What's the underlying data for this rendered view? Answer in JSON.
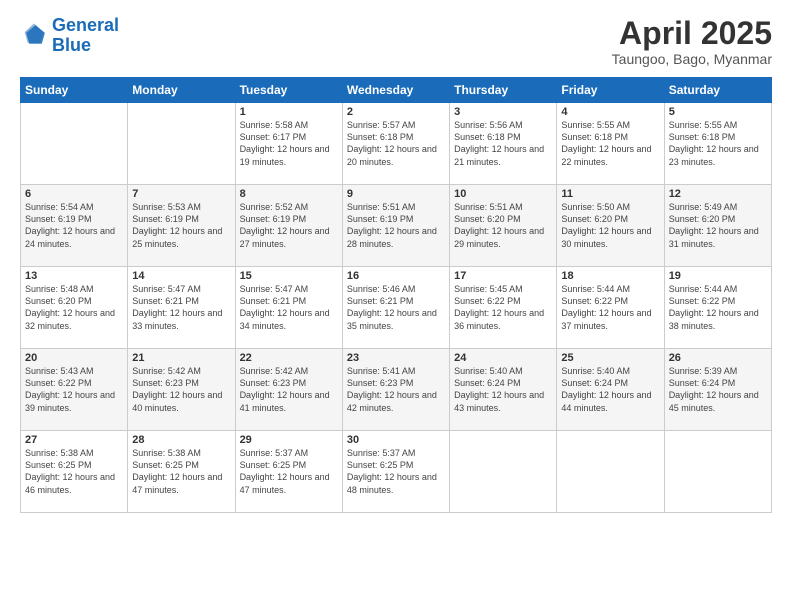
{
  "logo": {
    "line1": "General",
    "line2": "Blue"
  },
  "header": {
    "month": "April 2025",
    "location": "Taungoo, Bago, Myanmar"
  },
  "weekdays": [
    "Sunday",
    "Monday",
    "Tuesday",
    "Wednesday",
    "Thursday",
    "Friday",
    "Saturday"
  ],
  "weeks": [
    [
      null,
      null,
      {
        "day": "1",
        "sunrise": "Sunrise: 5:58 AM",
        "sunset": "Sunset: 6:17 PM",
        "daylight": "Daylight: 12 hours and 19 minutes."
      },
      {
        "day": "2",
        "sunrise": "Sunrise: 5:57 AM",
        "sunset": "Sunset: 6:18 PM",
        "daylight": "Daylight: 12 hours and 20 minutes."
      },
      {
        "day": "3",
        "sunrise": "Sunrise: 5:56 AM",
        "sunset": "Sunset: 6:18 PM",
        "daylight": "Daylight: 12 hours and 21 minutes."
      },
      {
        "day": "4",
        "sunrise": "Sunrise: 5:55 AM",
        "sunset": "Sunset: 6:18 PM",
        "daylight": "Daylight: 12 hours and 22 minutes."
      },
      {
        "day": "5",
        "sunrise": "Sunrise: 5:55 AM",
        "sunset": "Sunset: 6:18 PM",
        "daylight": "Daylight: 12 hours and 23 minutes."
      }
    ],
    [
      {
        "day": "6",
        "sunrise": "Sunrise: 5:54 AM",
        "sunset": "Sunset: 6:19 PM",
        "daylight": "Daylight: 12 hours and 24 minutes."
      },
      {
        "day": "7",
        "sunrise": "Sunrise: 5:53 AM",
        "sunset": "Sunset: 6:19 PM",
        "daylight": "Daylight: 12 hours and 25 minutes."
      },
      {
        "day": "8",
        "sunrise": "Sunrise: 5:52 AM",
        "sunset": "Sunset: 6:19 PM",
        "daylight": "Daylight: 12 hours and 27 minutes."
      },
      {
        "day": "9",
        "sunrise": "Sunrise: 5:51 AM",
        "sunset": "Sunset: 6:19 PM",
        "daylight": "Daylight: 12 hours and 28 minutes."
      },
      {
        "day": "10",
        "sunrise": "Sunrise: 5:51 AM",
        "sunset": "Sunset: 6:20 PM",
        "daylight": "Daylight: 12 hours and 29 minutes."
      },
      {
        "day": "11",
        "sunrise": "Sunrise: 5:50 AM",
        "sunset": "Sunset: 6:20 PM",
        "daylight": "Daylight: 12 hours and 30 minutes."
      },
      {
        "day": "12",
        "sunrise": "Sunrise: 5:49 AM",
        "sunset": "Sunset: 6:20 PM",
        "daylight": "Daylight: 12 hours and 31 minutes."
      }
    ],
    [
      {
        "day": "13",
        "sunrise": "Sunrise: 5:48 AM",
        "sunset": "Sunset: 6:20 PM",
        "daylight": "Daylight: 12 hours and 32 minutes."
      },
      {
        "day": "14",
        "sunrise": "Sunrise: 5:47 AM",
        "sunset": "Sunset: 6:21 PM",
        "daylight": "Daylight: 12 hours and 33 minutes."
      },
      {
        "day": "15",
        "sunrise": "Sunrise: 5:47 AM",
        "sunset": "Sunset: 6:21 PM",
        "daylight": "Daylight: 12 hours and 34 minutes."
      },
      {
        "day": "16",
        "sunrise": "Sunrise: 5:46 AM",
        "sunset": "Sunset: 6:21 PM",
        "daylight": "Daylight: 12 hours and 35 minutes."
      },
      {
        "day": "17",
        "sunrise": "Sunrise: 5:45 AM",
        "sunset": "Sunset: 6:22 PM",
        "daylight": "Daylight: 12 hours and 36 minutes."
      },
      {
        "day": "18",
        "sunrise": "Sunrise: 5:44 AM",
        "sunset": "Sunset: 6:22 PM",
        "daylight": "Daylight: 12 hours and 37 minutes."
      },
      {
        "day": "19",
        "sunrise": "Sunrise: 5:44 AM",
        "sunset": "Sunset: 6:22 PM",
        "daylight": "Daylight: 12 hours and 38 minutes."
      }
    ],
    [
      {
        "day": "20",
        "sunrise": "Sunrise: 5:43 AM",
        "sunset": "Sunset: 6:22 PM",
        "daylight": "Daylight: 12 hours and 39 minutes."
      },
      {
        "day": "21",
        "sunrise": "Sunrise: 5:42 AM",
        "sunset": "Sunset: 6:23 PM",
        "daylight": "Daylight: 12 hours and 40 minutes."
      },
      {
        "day": "22",
        "sunrise": "Sunrise: 5:42 AM",
        "sunset": "Sunset: 6:23 PM",
        "daylight": "Daylight: 12 hours and 41 minutes."
      },
      {
        "day": "23",
        "sunrise": "Sunrise: 5:41 AM",
        "sunset": "Sunset: 6:23 PM",
        "daylight": "Daylight: 12 hours and 42 minutes."
      },
      {
        "day": "24",
        "sunrise": "Sunrise: 5:40 AM",
        "sunset": "Sunset: 6:24 PM",
        "daylight": "Daylight: 12 hours and 43 minutes."
      },
      {
        "day": "25",
        "sunrise": "Sunrise: 5:40 AM",
        "sunset": "Sunset: 6:24 PM",
        "daylight": "Daylight: 12 hours and 44 minutes."
      },
      {
        "day": "26",
        "sunrise": "Sunrise: 5:39 AM",
        "sunset": "Sunset: 6:24 PM",
        "daylight": "Daylight: 12 hours and 45 minutes."
      }
    ],
    [
      {
        "day": "27",
        "sunrise": "Sunrise: 5:38 AM",
        "sunset": "Sunset: 6:25 PM",
        "daylight": "Daylight: 12 hours and 46 minutes."
      },
      {
        "day": "28",
        "sunrise": "Sunrise: 5:38 AM",
        "sunset": "Sunset: 6:25 PM",
        "daylight": "Daylight: 12 hours and 47 minutes."
      },
      {
        "day": "29",
        "sunrise": "Sunrise: 5:37 AM",
        "sunset": "Sunset: 6:25 PM",
        "daylight": "Daylight: 12 hours and 47 minutes."
      },
      {
        "day": "30",
        "sunrise": "Sunrise: 5:37 AM",
        "sunset": "Sunset: 6:25 PM",
        "daylight": "Daylight: 12 hours and 48 minutes."
      },
      null,
      null,
      null
    ]
  ]
}
